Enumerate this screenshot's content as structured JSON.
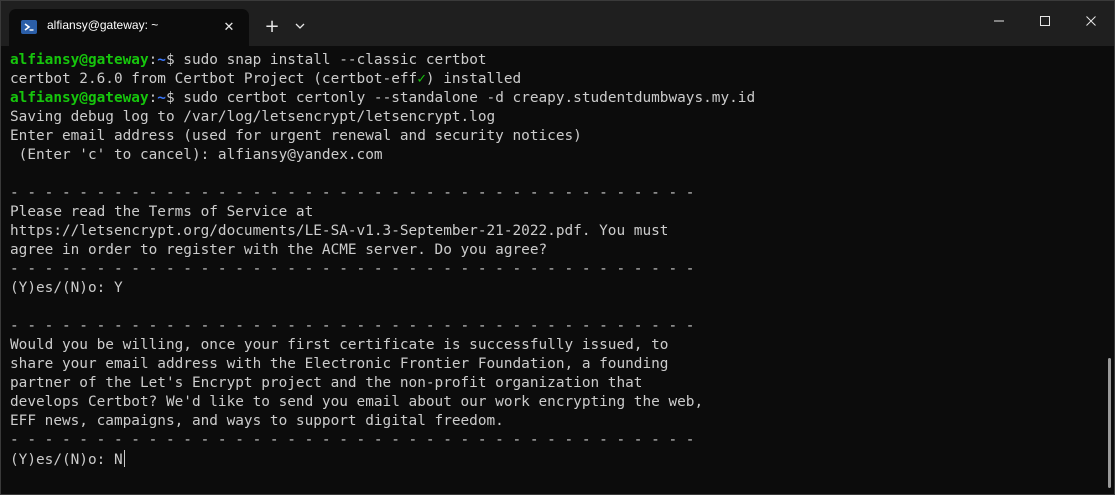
{
  "tab": {
    "title": "alfiansy@gateway: ~",
    "icon": "powershell-icon",
    "close_glyph": "✕",
    "new_tab_glyph": "+",
    "accent": "#2b5ea7"
  },
  "window_controls": [
    "minimize-icon",
    "maximize-icon",
    "close-icon"
  ],
  "colors": {
    "background": "#0c0c0c",
    "text": "#cccccc",
    "prompt_user": "#16c60c",
    "prompt_path": "#3b78ff"
  },
  "prompt": {
    "user_host": "alfiansy@gateway",
    "colon": ":",
    "path": "~",
    "symbol": "$ "
  },
  "terminal": {
    "cmd1": "sudo snap install --classic certbot",
    "install_pre": "certbot 2.6.0 from Certbot Project (certbot-eff",
    "install_check": "✓",
    "install_post": ") installed",
    "cmd2": "sudo certbot certonly --standalone -d creapy.studentdumbways.my.id",
    "out1": "Saving debug log to /var/log/letsencrypt/letsencrypt.log",
    "out2": "Enter email address (used for urgent renewal and security notices)",
    "out3": " (Enter 'c' to cancel): alfiansy@yandex.com",
    "blank": "",
    "divider": "- - - - - - - - - - - - - - - - - - - - - - - - - - - - - - - - - - - - - - - -",
    "tos1": "Please read the Terms of Service at",
    "tos2": "https://letsencrypt.org/documents/LE-SA-v1.3-September-21-2022.pdf. You must",
    "tos3": "agree in order to register with the ACME server. Do you agree?",
    "answer1": "(Y)es/(N)o: Y",
    "eff1": "Would you be willing, once your first certificate is successfully issued, to",
    "eff2": "share your email address with the Electronic Frontier Foundation, a founding",
    "eff3": "partner of the Let's Encrypt project and the non-profit organization that",
    "eff4": "develops Certbot? We'd like to send you email about our work encrypting the web,",
    "eff5": "EFF news, campaigns, and ways to support digital freedom.",
    "answer2": "(Y)es/(N)o: N"
  }
}
